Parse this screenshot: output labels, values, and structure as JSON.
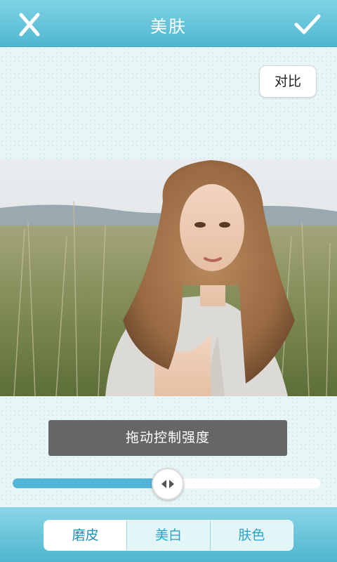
{
  "header": {
    "title": "美肤"
  },
  "compare_button": "对比",
  "hint": "拖动控制强度",
  "slider": {
    "value": 0.5
  },
  "tabs": [
    {
      "label": "磨皮",
      "active": true
    },
    {
      "label": "美白",
      "active": false
    },
    {
      "label": "肤色",
      "active": false
    }
  ],
  "colors": {
    "header_top": "#7fd3e4",
    "header_bottom": "#4fb7d0",
    "slider_fill": "#52b4d6",
    "hint_bg": "#666666"
  }
}
